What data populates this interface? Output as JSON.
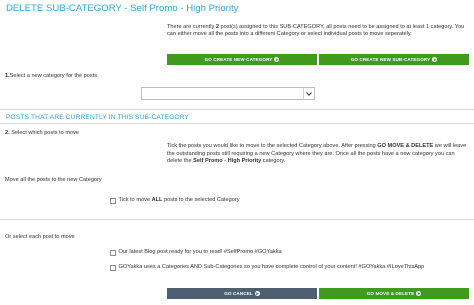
{
  "header": {
    "title": "DELETE SUB-CATEGORY - Self Promo - High Priority"
  },
  "info": {
    "text_before": "There are currently ",
    "count": "2",
    "text_after": " post(s) assigned to this SUB-CATEGORY, all posts need to be assigned to at least 1 category. You can either move all the posts into a different Category or select individual posts to move seperately."
  },
  "buttons": {
    "create_category": "GO CREATE NEW CATEGORY",
    "create_subcategory": "GO CREATE NEW SUB-CATEGORY",
    "cancel": "GO CANCEL",
    "move_delete": "GO MOVE & DELETE"
  },
  "step1": {
    "number": "1.",
    "label": "Select a new category for the posts",
    "select_value": ""
  },
  "section": {
    "title": "POSTS THAT ARE CURRENTLY IN THIS SUB-CATEGORY"
  },
  "step2": {
    "number": "2.",
    "label": "Select which posts to move"
  },
  "description": {
    "part1": "Tick the posts you would like to move to the selected Category above. After pressing ",
    "bold1": "GO MOVE & DELETE",
    "part2": " we will leave the outstanding posts still requiring a new Category where they are. Once all the posts have a new category you can delete the ",
    "bold2": "Self Promo - High Priority",
    "part3": " category."
  },
  "move_all": {
    "label": "Move all the posts to the new Category",
    "checkbox_before": "Tick to move ",
    "checkbox_bold": "ALL",
    "checkbox_after": " posts to the selected Category"
  },
  "move_each": {
    "label": "Or select each post to move",
    "posts": [
      {
        "text": "Our latest Blog post ready for you to read! #SelfPromo #GOYakka"
      },
      {
        "text": "GOYakka uses a Categories AND Sub-Categories so you have complete control of your content! #GOYakka #ILoveThisApp"
      }
    ]
  },
  "colors": {
    "accent_blue": "#2aa7d6",
    "button_green": "#3f9a1e",
    "button_slate": "#4d5f70"
  }
}
